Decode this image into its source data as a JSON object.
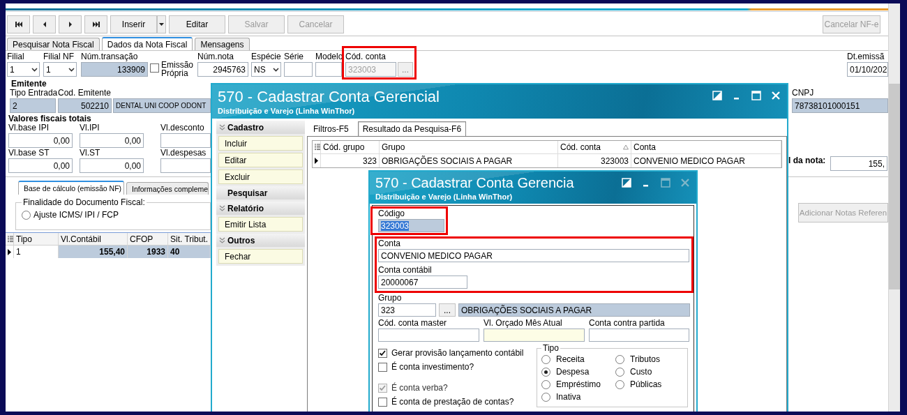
{
  "form": {
    "toolbar": {
      "buttons": [
        {
          "label": "Inserir",
          "disabled": false,
          "dropdown": true
        },
        {
          "label": "Editar",
          "disabled": false,
          "dropdown": false
        },
        {
          "label": "Salvar",
          "disabled": true,
          "dropdown": false
        },
        {
          "label": "Cancelar",
          "disabled": true,
          "dropdown": false
        }
      ],
      "right_buttons": [
        {
          "label": "Cancelar NF-e",
          "disabled": true
        }
      ]
    },
    "tabs": [
      {
        "label": "Pesquisar Nota Fiscal",
        "selected": false
      },
      {
        "label": "Dados da Nota Fiscal",
        "selected": true
      },
      {
        "label": "Mensagens",
        "selected": false
      }
    ],
    "header_fields": [
      {
        "label": "Filial",
        "value": "1",
        "kind": "combo"
      },
      {
        "label": "Filial NF",
        "value": "1",
        "kind": "combo"
      },
      {
        "label": "Núm.transação",
        "value": "133909",
        "kind": "readonly"
      },
      {
        "label": "Emissão Própria",
        "kind": "checkbox",
        "checked": false
      },
      {
        "label": "Núm.nota",
        "value": "2945763",
        "kind": "number"
      },
      {
        "label": "Espécie",
        "value": "NS",
        "kind": "combo"
      },
      {
        "label": "Série",
        "kind": "text"
      },
      {
        "label": "Modelo",
        "kind": "text"
      },
      {
        "label": "Cód. conta",
        "value": "323003",
        "kind": "lookup",
        "button": "...",
        "disabled": true,
        "highlighted": true
      },
      {
        "label": "Dt.emissã",
        "value": "01/10/202",
        "kind": "text"
      }
    ],
    "emitente": {
      "title": "Emitente",
      "fields": [
        {
          "label": "Tipo Entrada",
          "value": "2"
        },
        {
          "label": "Cod. Emitente",
          "value": "502210"
        },
        {
          "value": "DENTAL UNI COOP ODONT"
        }
      ],
      "cnpj": {
        "label": "CNPJ",
        "value": "78738101000151"
      }
    },
    "valores": {
      "title": "Valores fiscais totais",
      "fields": [
        {
          "label": "Vl.base IPI",
          "value": "0,00"
        },
        {
          "label": "Vl.IPI",
          "value": "0,00"
        },
        {
          "label": "Vl.desconto"
        },
        {
          "label": "Vl.base ST",
          "value": "0,00"
        },
        {
          "label": "Vl.ST",
          "value": "0,00"
        },
        {
          "label": "Vl.despesas"
        }
      ],
      "total": {
        "label": "l da nota:",
        "value": "155,"
      }
    },
    "lower_tabs": [
      {
        "label": "Base de cálculo (emissão NF)",
        "selected": true
      },
      {
        "label": "Informações compleme",
        "selected": false
      }
    ],
    "finalidade": {
      "title": "Finalidade do Documento Fiscal:",
      "options": [
        {
          "label": "Ajuste ICMS/ IPI / FCP",
          "selected": false
        }
      ]
    },
    "items_grid": {
      "columns": [
        "Tipo",
        "Vl.Contábil",
        "CFOP",
        "Sit. Tribut."
      ],
      "rows": [
        {
          "cells": [
            "1",
            "155,40",
            "1933",
            "40"
          ],
          "selected": true
        }
      ]
    },
    "add_button": {
      "label": "Adicionar Notas Referen",
      "disabled": true
    }
  },
  "list_window": {
    "title": "570 - Cadastrar Conta Gerencial",
    "subtitle": "Distribuição e Varejo (Linha WinThor)",
    "window_buttons": [
      {
        "kind": "restore",
        "disabled": false
      },
      {
        "kind": "minimize",
        "disabled": false
      },
      {
        "kind": "maximize",
        "disabled": false
      },
      {
        "kind": "close",
        "disabled": false
      }
    ],
    "menu": [
      {
        "title": "Cadastro",
        "collapsible": true,
        "items": [
          "Incluir",
          "Editar",
          "Excluir"
        ]
      },
      {
        "title": "Pesquisar",
        "collapsible": false
      },
      {
        "title": "Relatório",
        "collapsible": true,
        "items": [
          "Emitir Lista"
        ]
      },
      {
        "title": "Outros",
        "collapsible": true,
        "items": [
          "Fechar"
        ]
      }
    ],
    "tabs": [
      {
        "label": "Filtros-F5",
        "selected": false
      },
      {
        "label": "Resultado da Pesquisa-F6",
        "selected": true
      }
    ],
    "grid": {
      "columns": [
        {
          "label": "Cód. grupo",
          "sorted": false
        },
        {
          "label": "Grupo",
          "sorted": false
        },
        {
          "label": "Cód. conta",
          "sorted": true
        },
        {
          "label": "Conta",
          "sorted": false
        }
      ],
      "rows": [
        {
          "cells": [
            "323",
            "OBRIGAÇÕES SOCIAIS A PAGAR",
            "323003",
            "CONVENIO MEDICO PAGAR"
          ],
          "selected": true
        }
      ]
    }
  },
  "edit_window": {
    "title": "570 - Cadastrar Conta Gerencia",
    "subtitle": "Distribuição e Varejo (Linha WinThor)",
    "window_buttons": [
      {
        "kind": "restore",
        "disabled": false
      },
      {
        "kind": "minimize",
        "disabled": false
      },
      {
        "kind": "maximize",
        "disabled": true
      },
      {
        "kind": "close",
        "disabled": true
      }
    ],
    "codigo": {
      "label": "Código",
      "value": "323003",
      "highlighted": true
    },
    "conta_group": {
      "highlighted": true,
      "fields": [
        {
          "label": "Conta",
          "value": "CONVENIO MEDICO PAGAR"
        },
        {
          "label": "Conta contábil",
          "value": "20000067"
        }
      ]
    },
    "grupo": {
      "label": "Grupo",
      "code": "323",
      "button": "...",
      "name": "OBRIGAÇÕES SOCIAIS A PAGAR"
    },
    "extra_fields": [
      {
        "label": "Cód. conta master",
        "kind": "text"
      },
      {
        "label": "Vl. Orçado Mês Atual",
        "kind": "money"
      },
      {
        "label": "Conta contra partida",
        "kind": "text"
      }
    ],
    "options": [
      {
        "label": "Gerar provisão lançamento contábil",
        "checked": true,
        "disabled": false
      },
      {
        "label": "É conta investimento?",
        "checked": false,
        "disabled": false
      },
      {
        "label": "É conta verba?",
        "checked": true,
        "disabled": true
      },
      {
        "label": "É conta de prestação de contas?",
        "checked": false,
        "disabled": false
      }
    ],
    "tipo": {
      "title": "Tipo",
      "options": [
        {
          "label": "Receita",
          "selected": false
        },
        {
          "label": "Tributos",
          "selected": false
        },
        {
          "label": "Despesa",
          "selected": true
        },
        {
          "label": "Custo",
          "selected": false
        },
        {
          "label": "Empréstimo",
          "selected": false
        },
        {
          "label": "Públicas",
          "selected": false
        },
        {
          "label": "Inativa",
          "selected": false
        }
      ]
    }
  }
}
